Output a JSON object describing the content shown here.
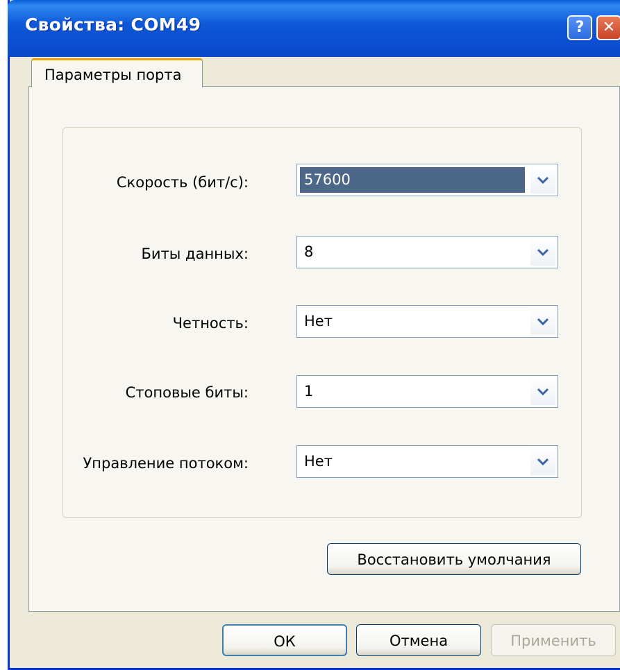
{
  "window": {
    "title": "Свойства: COM49",
    "help_label": "?",
    "close_label": "✕"
  },
  "tabs": [
    {
      "label": "Параметры порта",
      "active": true
    }
  ],
  "fields": [
    {
      "label": "Скорость (бит/с):",
      "value": "57600",
      "selected": true
    },
    {
      "label": "Биты данных:",
      "value": "8",
      "selected": false
    },
    {
      "label": "Четность:",
      "value": "Нет",
      "selected": false
    },
    {
      "label": "Стоповые биты:",
      "value": "1",
      "selected": false
    },
    {
      "label": "Управление потоком:",
      "value": "Нет",
      "selected": false
    }
  ],
  "buttons": {
    "restore_defaults": "Восстановить умолчания",
    "ok": "ОК",
    "cancel": "Отмена",
    "apply": "Применить"
  },
  "colors": {
    "titlebar": "#0b52d0",
    "dialog_bg": "#ece9d8",
    "tab_panel_bg": "#f7f6f0",
    "selected_value_bg": "#4d6788",
    "active_tab_accent": "#e8a10c",
    "disabled_text": "#aca899"
  },
  "icons": {
    "help": "help-icon",
    "close": "close-icon",
    "dropdown": "chevron-down-icon"
  }
}
